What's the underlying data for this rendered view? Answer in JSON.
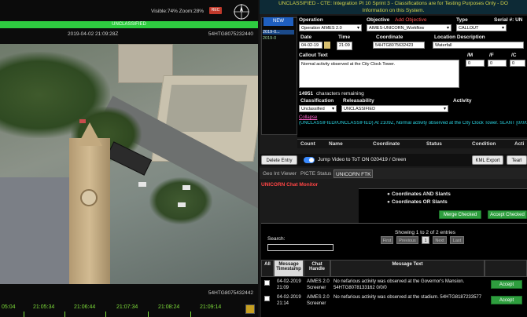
{
  "video": {
    "visible_zoom": "Visible:74% Zoom:28%",
    "rec_badge": "REC",
    "classification": "UNCLASSIFIED",
    "timestamp": "2019-04-02 21:09:28Z",
    "frame_id_top": "54HTG8075232440",
    "frame_id_bottom": "54HTG8075432442",
    "timeline": [
      "05:04",
      "21:05:34",
      "21:06:44",
      "21:07:34",
      "21:08:24",
      "21:09:14"
    ]
  },
  "banner": {
    "line1": "UNCLASSIFIED - CTE: Integration PI 10 Sprint 3 - Classifications are for Testing Purposes Only - DO",
    "line2": "Information on this System."
  },
  "entries": {
    "new_label": "NEW",
    "items": [
      "2019-0...",
      "2019-0"
    ]
  },
  "form": {
    "operation_label": "Operation",
    "operation_value": "Operation AIMES 2.0",
    "objective_label": "Objective",
    "add_objective": "Add Objective",
    "objective_value": "AIMES-UNICORN_Workflow",
    "type_label": "Type",
    "type_value": "CALLOUT",
    "serial_label": "Serial #: UN",
    "date_label": "Date",
    "date_value": "04-02-19",
    "time_label": "Time",
    "time_value": "21:09",
    "coord_label": "Coordinate",
    "coord_value": "54HTG8075632423",
    "location_label": "Location Description",
    "location_value": "Waterfall",
    "callout_label": "Callout Text",
    "callout_value": "Normal activity observed at the City Clock Tower.",
    "m_label": "/M",
    "f_label": "/F",
    "c_label": "/C",
    "m_value": "0",
    "f_value": "0",
    "c_value": "0",
    "remaining_count": "14951",
    "remaining_text": "characters remaining",
    "classification_label": "Classification",
    "classification_value": "Unclassified",
    "releasability_label": "Releasability",
    "releasability_value": "UNCLASSIFIED",
    "activity_label": "Activity",
    "collapse": "Collapse",
    "summary": "(UNCLASSIFIED//UNCLASSIFIED) At 2109Z, Normal activity observed at the City Clock Tower. SLANT [0/0/0]"
  },
  "entry_table": {
    "headers": [
      "Count",
      "Name",
      "Coordinate",
      "Status",
      "Condition",
      "Acti"
    ]
  },
  "toolbar": {
    "delete_entry": "Delete Entry",
    "jump_video": "Jump Video to ToT ON 020419 / Green",
    "kml_export": "KML Export",
    "tearline": "Tearl"
  },
  "tabs": [
    "Geo Int Viewer",
    "PICTE Status",
    "UNICORN FTK"
  ],
  "chat": {
    "title": "UNICORN Chat Monitor",
    "radio1": "Coordinates AND Slants",
    "radio2": "Coordinates OR Slants",
    "merge_checked": "Merge Checked",
    "accept_checked": "Accept Checked",
    "search_label": "Search:",
    "showing": "Showing 1 to 2 of 2 entries",
    "paging": [
      "First",
      "Previous",
      "1",
      "Next",
      "Last"
    ],
    "headers": [
      "All",
      "Message Timestamp",
      "Chat Handle",
      "Message Text"
    ],
    "rows": [
      {
        "timestamp": "04-02-2019 21:09",
        "handle": "AIMES 2.0 Screener",
        "text": "No nefarious activity was observed at the Governor's Mansion. 54HTG8078133162 0/0/0",
        "action": "Accept"
      },
      {
        "timestamp": "04-02-2019 21:14",
        "handle": "AIMES 2.0 Screener",
        "text": "No nefarious activity was observed at the stadium. 54HTG8187233577",
        "action": "Accept"
      }
    ]
  },
  "colors": {
    "classification_green": "#2ecc40",
    "summary_cyan": "#2ad4e2",
    "accept_green": "#2e9e3e",
    "label_red": "#ff4545"
  }
}
